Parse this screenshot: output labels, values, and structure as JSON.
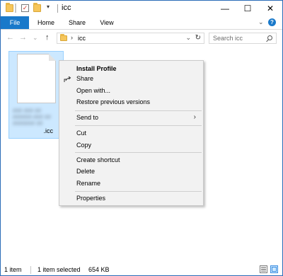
{
  "title": "icc",
  "window_controls": {
    "minimize": "—",
    "maximize": "☐",
    "close": "✕"
  },
  "ribbon": {
    "tabs": [
      "File",
      "Home",
      "Share",
      "View"
    ],
    "expand_glyph": "⌄",
    "help_glyph": "?"
  },
  "nav": {
    "back": "←",
    "forward": "→",
    "recent": "⌄",
    "up": "↑",
    "address_chevron": "›",
    "address_text": "icc",
    "address_dropdown": "⌄",
    "refresh": "↻",
    "search_placeholder": "Search icc"
  },
  "file": {
    "label": ".icc",
    "blurred_lines": [
      "### ### ##",
      "######-### ##",
      "####### ##"
    ]
  },
  "context_menu": {
    "items": [
      {
        "label": "Install Profile",
        "bold": true
      },
      {
        "label": "Share",
        "icon": "share-icon"
      },
      {
        "label": "Open with..."
      },
      {
        "label": "Restore previous versions"
      },
      {
        "label": "Send to",
        "submenu": true
      },
      {
        "label": "Cut"
      },
      {
        "label": "Copy"
      },
      {
        "label": "Create shortcut"
      },
      {
        "label": "Delete"
      },
      {
        "label": "Rename"
      },
      {
        "label": "Properties"
      }
    ],
    "submenu_arrow": "›"
  },
  "status": {
    "items": "1 item",
    "selected": "1 item selected",
    "size": "654 KB"
  },
  "colors": {
    "accent": "#1979ca",
    "selection_bg": "#cce8ff",
    "selection_border": "#99d1ff",
    "menu_bg": "#f2f2f2"
  }
}
